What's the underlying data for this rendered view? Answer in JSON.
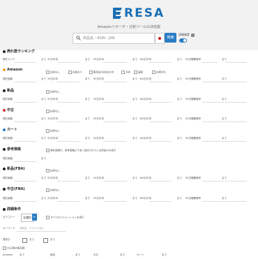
{
  "header": {
    "logo_text": "RESA",
    "tagline": "Amazonリサーチ・分析ツールの決定版",
    "search_placeholder": "商品名・ASIN・JAN",
    "search_button": "検索",
    "advanced_label": "詳細検索"
  },
  "sections": {
    "ranking": "売れ筋ランキング",
    "amazon": "Amazon",
    "new": "新品",
    "used": "中古",
    "cart": "カート",
    "reference": "参考価格",
    "new_fba": "新品(FBA)",
    "used_fba": "中古(FBA)",
    "detail": "詳細条件"
  },
  "fields": {
    "current_rank": "現在ランク",
    "current_price": "現在価格",
    "to": "まで",
    "avg30": "30日平均",
    "avg90": "90日平均",
    "avg180": "180日平均",
    "change90": "90日間騰落率",
    "no_data": "在庫なし",
    "in_stock": "在庫あり",
    "prime": "プライム",
    "ref_note": "現在価格が、参考価格より安く設定されている商品のみ表示"
  },
  "amazon_flags": [
    "在庫なし",
    "在庫あり",
    "販売前/予約注文中",
    "予約",
    "直販",
    "在庫切れ"
  ],
  "detail": {
    "category_label": "カテゴリー",
    "category_value": "全選択",
    "keyword_label": "キーワード",
    "keyword_placeholder": "商品名・ブランドなど",
    "date_label": "発売日",
    "variation_label": "すべてのバリエーションを表示",
    "period_label": "30日間の販売数",
    "bottom_labels": [
      "Amazon",
      "新品",
      "中古",
      "カート"
    ]
  },
  "colors": {
    "accent": "#2b7dc4",
    "amazon_dot": "#f0a020",
    "new_dot": "#222222",
    "used_dot": "#d33333",
    "cart_dot": "#2b7dc4"
  }
}
